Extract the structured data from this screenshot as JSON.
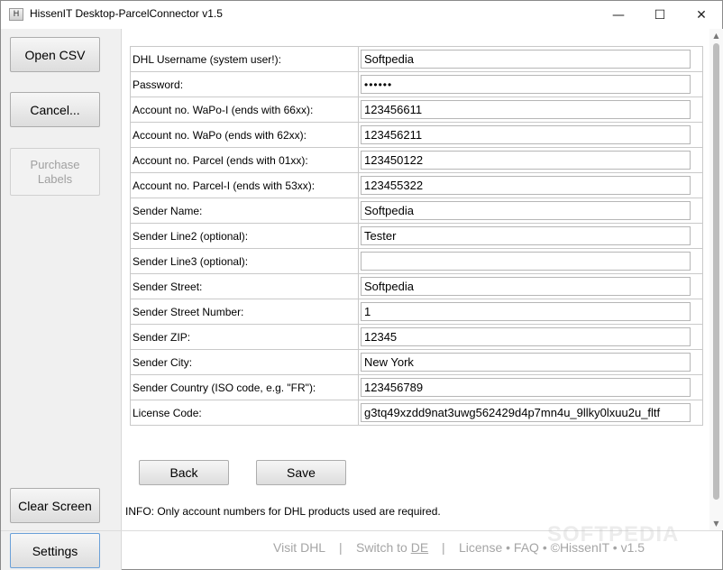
{
  "window": {
    "title": "HissenIT Desktop-ParcelConnector v1.5",
    "icon_glyph": "H",
    "controls": {
      "minimize": "—",
      "maximize": "☐",
      "close": "✕"
    }
  },
  "sidebar": {
    "open_csv": "Open CSV",
    "cancel": "Cancel...",
    "purchase_labels_line1": "Purchase",
    "purchase_labels_line2": "Labels",
    "clear_screen": "Clear Screen",
    "settings": "Settings"
  },
  "form": {
    "rows": [
      {
        "label": "DHL Username (system user!):",
        "value": "Softpedia"
      },
      {
        "label": "Password:",
        "value": "••••••"
      },
      {
        "label": "Account no. WaPo-I (ends with 66xx):",
        "value": "123456611"
      },
      {
        "label": "Account no. WaPo (ends with 62xx):",
        "value": "123456211"
      },
      {
        "label": "Account no. Parcel (ends with 01xx):",
        "value": "123450122"
      },
      {
        "label": "Account no. Parcel-I (ends with 53xx):",
        "value": "123455322"
      },
      {
        "label": "Sender Name:",
        "value": "Softpedia"
      },
      {
        "label": "Sender Line2 (optional):",
        "value": "Tester"
      },
      {
        "label": "Sender Line3 (optional):",
        "value": ""
      },
      {
        "label": "Sender Street:",
        "value": "Softpedia"
      },
      {
        "label": "Sender Street Number:",
        "value": "1"
      },
      {
        "label": "Sender ZIP:",
        "value": "12345"
      },
      {
        "label": "Sender City:",
        "value": "New York"
      },
      {
        "label": "Sender Country (ISO code, e.g. \"FR\"):",
        "value": "123456789"
      },
      {
        "label": "License Code:",
        "value": "g3tq49xzdd9nat3uwg562429d4p7mn4u_9llky0lxuu2u_fltf"
      }
    ]
  },
  "actions": {
    "back": "Back",
    "save": "Save"
  },
  "info": "INFO: Only account numbers for DHL products used are required.",
  "footer": {
    "visit": "Visit DHL",
    "sep": "|",
    "switch_prefix": "Switch to ",
    "switch_lang": "DE",
    "license_etc": "License • FAQ • ©HissenIT • v1.5"
  },
  "watermark": "SOFTPEDIA",
  "scrollbar": {
    "up": "▲",
    "down": "▼"
  }
}
